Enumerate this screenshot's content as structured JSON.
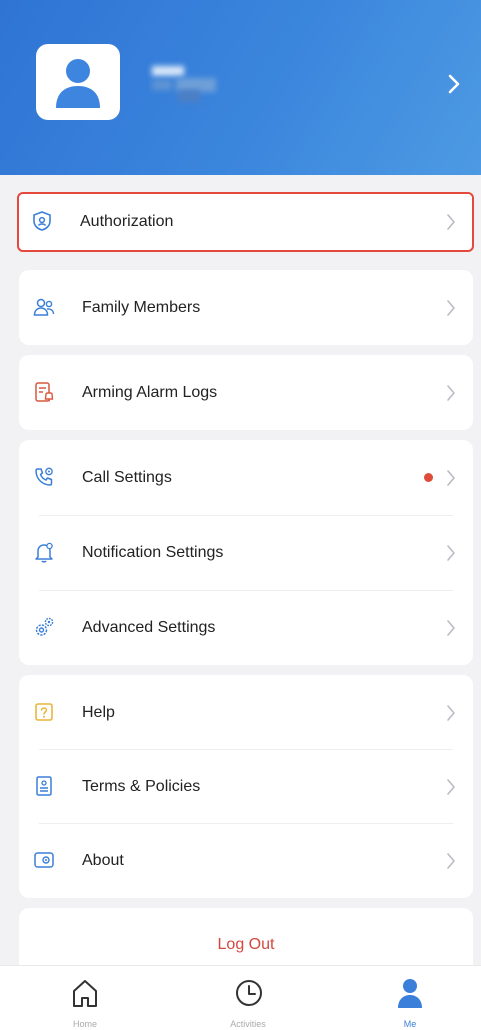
{
  "profile": {
    "avatar_icon": "user-avatar-icon",
    "name": "",
    "chevron_icon": "chevron-right-icon"
  },
  "menu": {
    "group1": [
      {
        "label": "Authorization",
        "icon": "shield-user-icon"
      }
    ],
    "group2": [
      {
        "label": "Family Members",
        "icon": "people-icon"
      }
    ],
    "group3": [
      {
        "label": "Arming Alarm Logs",
        "icon": "log-bell-icon"
      }
    ],
    "group4": [
      {
        "label": "Call Settings",
        "icon": "phone-icon",
        "badge": "red-dot"
      },
      {
        "label": "Notification Settings",
        "icon": "bell-icon"
      },
      {
        "label": "Advanced Settings",
        "icon": "gears-icon"
      }
    ],
    "group5": [
      {
        "label": "Help",
        "icon": "help-icon"
      },
      {
        "label": "Terms & Policies",
        "icon": "document-icon"
      },
      {
        "label": "About",
        "icon": "info-card-icon"
      }
    ]
  },
  "logout": {
    "label": "Log Out"
  },
  "tabbar": {
    "tabs": [
      {
        "label": "Home",
        "icon": "home-icon"
      },
      {
        "label": "Activities",
        "icon": "clock-icon"
      },
      {
        "label": "Me",
        "icon": "person-icon",
        "active": true
      }
    ]
  },
  "colors": {
    "header_start": "#2f74d4",
    "header_end": "#4d9ae3",
    "accent_blue": "#3a7fd9",
    "logout_red": "#d4473e",
    "badge_red": "#e04b3a",
    "highlight_red": "#e5483c",
    "help_yellow": "#e8b53a",
    "alarm_red": "#d9593f"
  }
}
